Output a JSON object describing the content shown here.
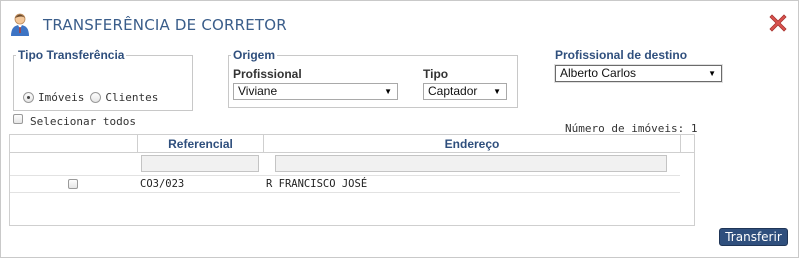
{
  "dialog": {
    "title": "TRANSFERÊNCIA DE CORRETOR",
    "user_icon": "user-icon",
    "close_icon": "close-icon"
  },
  "tipo_transferencia": {
    "legend": "Tipo Transferência",
    "options": [
      {
        "label": "Imóveis",
        "checked": true
      },
      {
        "label": "Clientes",
        "checked": false
      }
    ]
  },
  "origem": {
    "legend": "Origem",
    "profissional_label": "Profissional",
    "profissional_value": "Viviane",
    "tipo_label": "Tipo",
    "tipo_value": "Captador"
  },
  "destino": {
    "label": "Profissional de destino",
    "value": "Alberto Carlos"
  },
  "selecionar_todos": "Selecionar todos",
  "numero_imoveis": "Número de imóveis: 1",
  "grid": {
    "columns": [
      "",
      "Referencial",
      "Endereço"
    ],
    "rows": [
      {
        "checked": false,
        "referencial": "CO3/023",
        "endereco": "R FRANCISCO JOSÉ"
      }
    ]
  },
  "buttons": {
    "transferir": "Transferir"
  },
  "colors": {
    "accent": "#2f4f7d",
    "title": "#3a5d8a",
    "close": "#d9534f"
  }
}
